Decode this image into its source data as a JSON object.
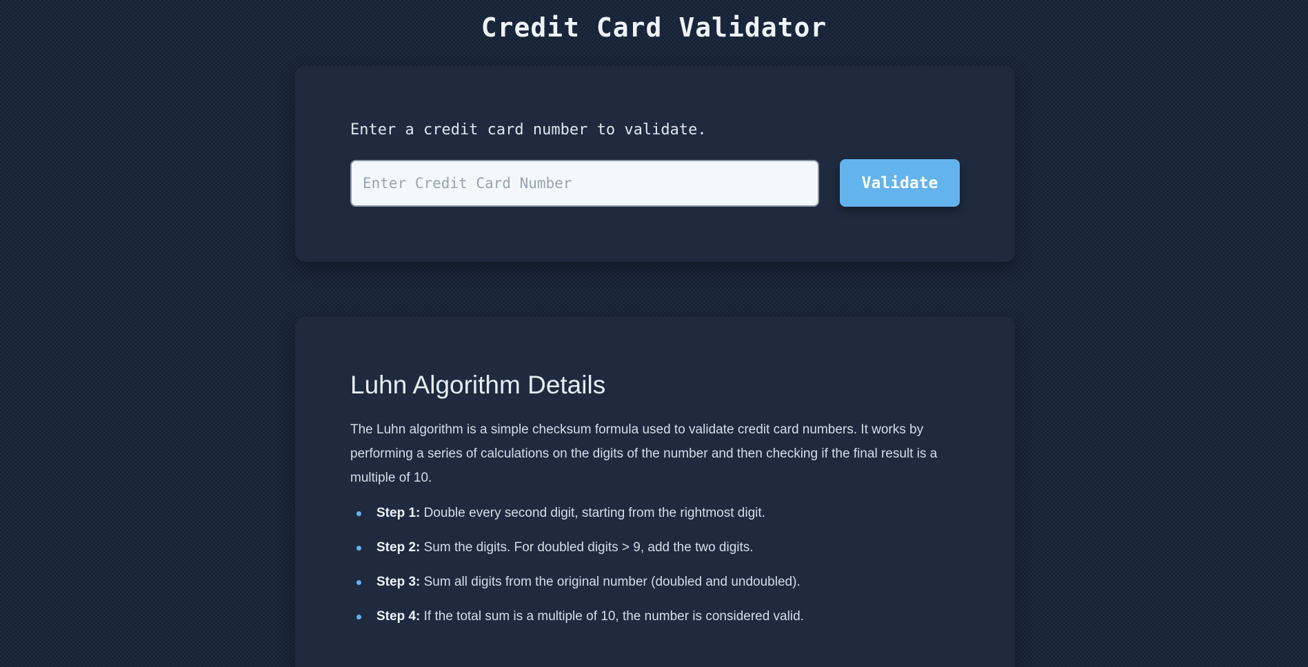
{
  "header": {
    "title": "Credit Card Validator"
  },
  "validator": {
    "instruction": "Enter a credit card number to validate.",
    "input_value": "",
    "input_placeholder": "Enter Credit Card Number",
    "button_label": "Validate",
    "accent_color": "#63b3ed"
  },
  "details": {
    "heading": "Luhn Algorithm Details",
    "description": "The Luhn algorithm is a simple checksum formula used to validate credit card numbers. It works by performing a series of calculations on the digits of the number and then checking if the final result is a multiple of 10.",
    "steps": [
      {
        "label": "Step 1:",
        "text": " Double every second digit, starting from the rightmost digit."
      },
      {
        "label": "Step 2:",
        "text": " Sum the digits. For doubled digits > 9, add the two digits."
      },
      {
        "label": "Step 3:",
        "text": " Sum all digits from the original number (doubled and undoubled)."
      },
      {
        "label": "Step 4:",
        "text": " If the total sum is a multiple of 10, the number is considered valid."
      }
    ]
  }
}
